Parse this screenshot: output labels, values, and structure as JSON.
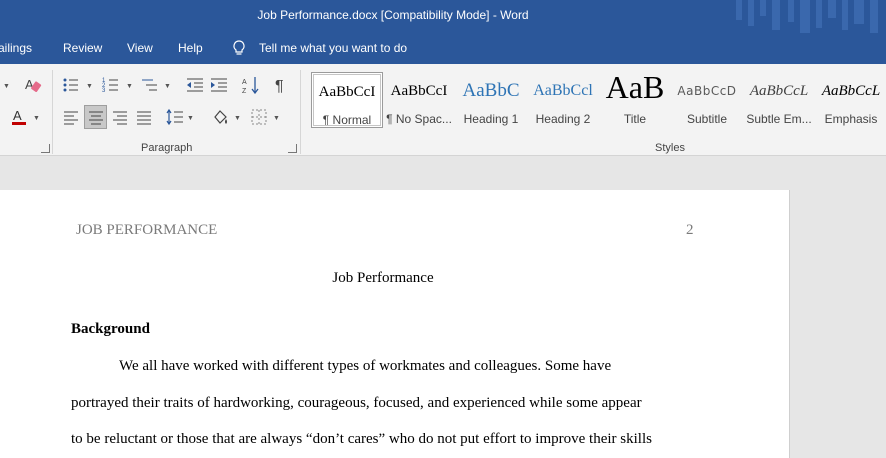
{
  "window": {
    "title": "Job Performance.docx [Compatibility Mode]  -  Word"
  },
  "menu": {
    "items": [
      "ailings",
      "Review",
      "View",
      "Help"
    ],
    "tell_me": "Tell me what you want to do"
  },
  "ribbon": {
    "paragraph_label": "Paragraph",
    "styles_label": "Styles",
    "styles": [
      {
        "sample": "AaBbCcI",
        "name": "¶ Normal"
      },
      {
        "sample": "AaBbCcI",
        "name": "¶ No Spac..."
      },
      {
        "sample": "AaBbC",
        "name": "Heading 1"
      },
      {
        "sample": "AaBbCcl",
        "name": "Heading 2"
      },
      {
        "sample": "AaB",
        "name": "Title"
      },
      {
        "sample": "AaBbCcD",
        "name": "Subtitle"
      },
      {
        "sample": "AaBbCcL",
        "name": "Subtle Em..."
      },
      {
        "sample": "AaBbCcL",
        "name": "Emphasis"
      }
    ],
    "font_color": "#c00000",
    "accent": "#2b579a"
  },
  "document": {
    "header_left": "JOB PERFORMANCE",
    "page_number": "2",
    "title": "Job Performance",
    "heading": "Background",
    "lines": [
      "We all have worked with different types of workmates and colleagues. Some have",
      "portrayed their traits of hardworking, courageous, focused, and experienced while some appear",
      "to be reluctant or those that are always “don’t cares” who do not put effort to improve their skills"
    ]
  }
}
